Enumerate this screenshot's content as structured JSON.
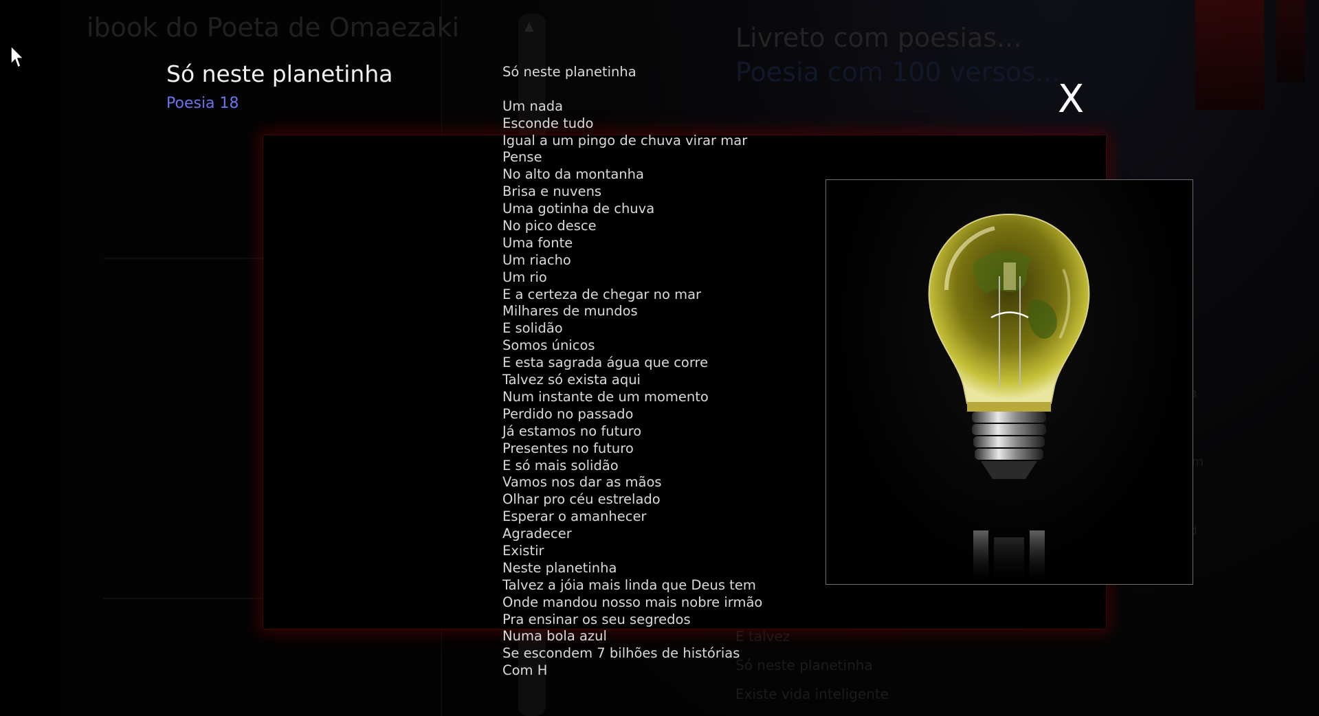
{
  "background": {
    "app_title": "ibook do Poeta de Omaezaki",
    "booklet_title": "Livreto com poesias...",
    "booklet_subtitle": "Poesia com 100 versos...",
    "list_items": [
      "E talvez",
      "Só neste planetinha",
      "Existe vida inteligente"
    ]
  },
  "modal": {
    "title": "Só neste planetinha",
    "poem_number": "Poesia 18",
    "close_label": "X",
    "poem_heading": "Só neste planetinha",
    "verses": [
      "Um nada",
      "Esconde tudo",
      "Igual a um pingo de chuva virar mar",
      "Pense",
      "No alto da montanha",
      "Brisa e nuvens",
      "Uma gotinha de chuva",
      "No pico desce",
      "Uma fonte",
      "Um riacho",
      "Um rio",
      "E a certeza de chegar no mar",
      "Milhares de mundos",
      "E solidão",
      "Somos únicos",
      "E esta sagrada água que corre",
      "Talvez só exista aqui",
      "Num instante de um momento",
      "Perdido no passado",
      "Já estamos no futuro",
      "Presentes no futuro",
      "E só mais solidão",
      "Vamos nos dar as mãos",
      "Olhar pro céu estrelado",
      "Esperar o amanhecer",
      "Agradecer",
      "Existir",
      "Neste planetinha",
      "Talvez a jóia mais linda que Deus tem",
      "Onde mandou nosso mais nobre irmão",
      "Pra ensinar os seu segredos",
      "Numa bola azul",
      "Se escondem 7 bilhões de histórias",
      "Com H"
    ],
    "image": {
      "subject": "light-bulb-with-earth-inside",
      "glass_tint": "#c8c23a",
      "background": "#000000"
    }
  },
  "colors": {
    "frame_glow": "#6e0000",
    "poem_number": "#6a74ee",
    "title": "#f2f2f2",
    "verse": "#dadada"
  }
}
